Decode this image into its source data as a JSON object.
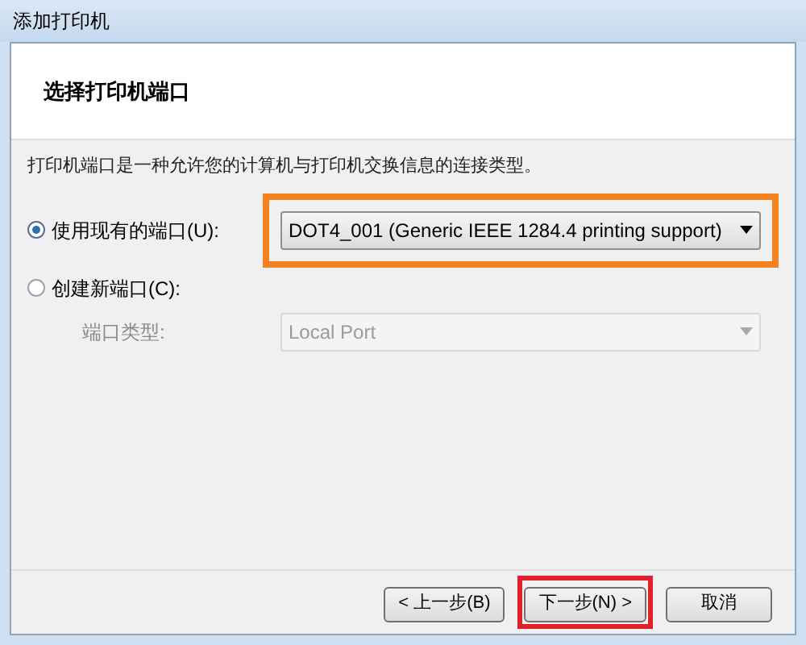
{
  "window": {
    "title": "添加打印机"
  },
  "header": {
    "title": "选择打印机端口"
  },
  "description": "打印机端口是一种允许您的计算机与打印机交换信息的连接类型。",
  "options": [
    {
      "label": "使用现有的端口(U):",
      "selected": true,
      "dropdown": {
        "value": "DOT4_001 (Generic IEEE 1284.4 printing support)",
        "disabled": false,
        "highlighted": true
      }
    },
    {
      "label": "创建新端口(C):",
      "selected": false,
      "sub_label": "端口类型:",
      "dropdown": {
        "value": "Local Port",
        "disabled": true,
        "highlighted": false
      }
    }
  ],
  "buttons": [
    {
      "label": "< 上一步(B)",
      "highlighted": false
    },
    {
      "label": "下一步(N) >",
      "highlighted": true
    },
    {
      "label": "取消",
      "highlighted": false
    }
  ]
}
